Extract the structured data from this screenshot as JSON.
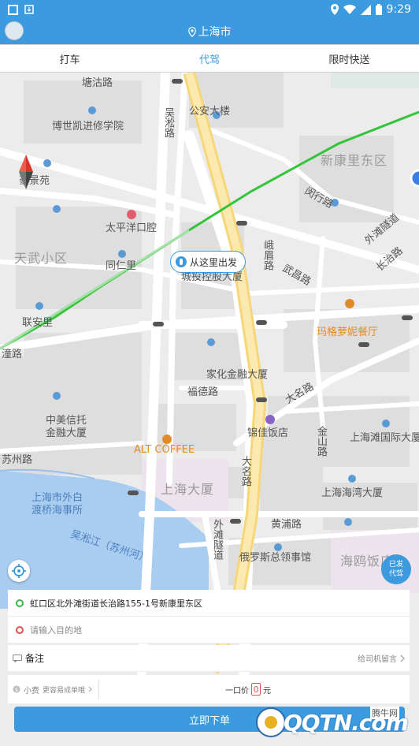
{
  "status": {
    "time": "9:29"
  },
  "header": {
    "city": "上海市"
  },
  "tabs": [
    {
      "label": "打车"
    },
    {
      "label": "代驾",
      "active": true
    },
    {
      "label": "限时快送"
    }
  ],
  "map": {
    "labels": {
      "tangshan_rd": "塘沽路",
      "wusong_rd": "吴淞路",
      "gongan": "公安大楼",
      "boshikai": "博世凯进修学院",
      "xinkangli": "新康里东区",
      "haojingyuan": "豪景苑",
      "taiping": "太平洋口腔",
      "tianwu": "天武小区",
      "tongrenli": "同仁里",
      "chengtou": "城投控股大厦",
      "minhang": "闵行路",
      "waitan_tunnel": "外滩隧道",
      "changzhi": "长治路",
      "emei": "峨眉路",
      "wuchang": "武昌路",
      "lianan": "联安里",
      "magrongni": "玛格萝妮餐厅",
      "tanglu": "潼路",
      "jiahua": "家化金融大厦",
      "fude": "福德路",
      "daming": "大名路",
      "zhongmei": "中美信托",
      "jinrong": "金融大厦",
      "jinjia": "锦佳饭店",
      "jinshan": "金山路",
      "waitanguoji": "上海滩国际大厦",
      "altcoffee": "ALT COFFEE",
      "suzhou_rd": "苏州路",
      "shanghai_mansion": "上海大厦",
      "dmingroad": "大名路",
      "haiwan": "上海海湾大厦",
      "waibaidu1": "上海市外白",
      "waibaidu2": "渡桥海事所",
      "huangpu": "黄浦路",
      "wusong_river": "吴淞江（苏州河）",
      "waitan_tunnel2": "外滩隧道",
      "russia": "俄罗斯总领事馆",
      "haioufan": "海鸥饭店"
    },
    "start_label": "从这里出发",
    "driver_badge": {
      "line1": "已发",
      "line2": "代驾"
    }
  },
  "form": {
    "from": "虹口区北外滩街道长治路155-1号新康里东区",
    "to_placeholder": "请输入目的地",
    "note_label": "备注",
    "note_hint": "给司机留言",
    "tip_label": "小费",
    "tip_hint": "更容易成单哦",
    "price_label": "一口价",
    "price_value": "0",
    "price_unit": "元",
    "submit": "立即下单"
  },
  "watermark": {
    "text": "QQTN.com",
    "sub": "腾牛网"
  }
}
